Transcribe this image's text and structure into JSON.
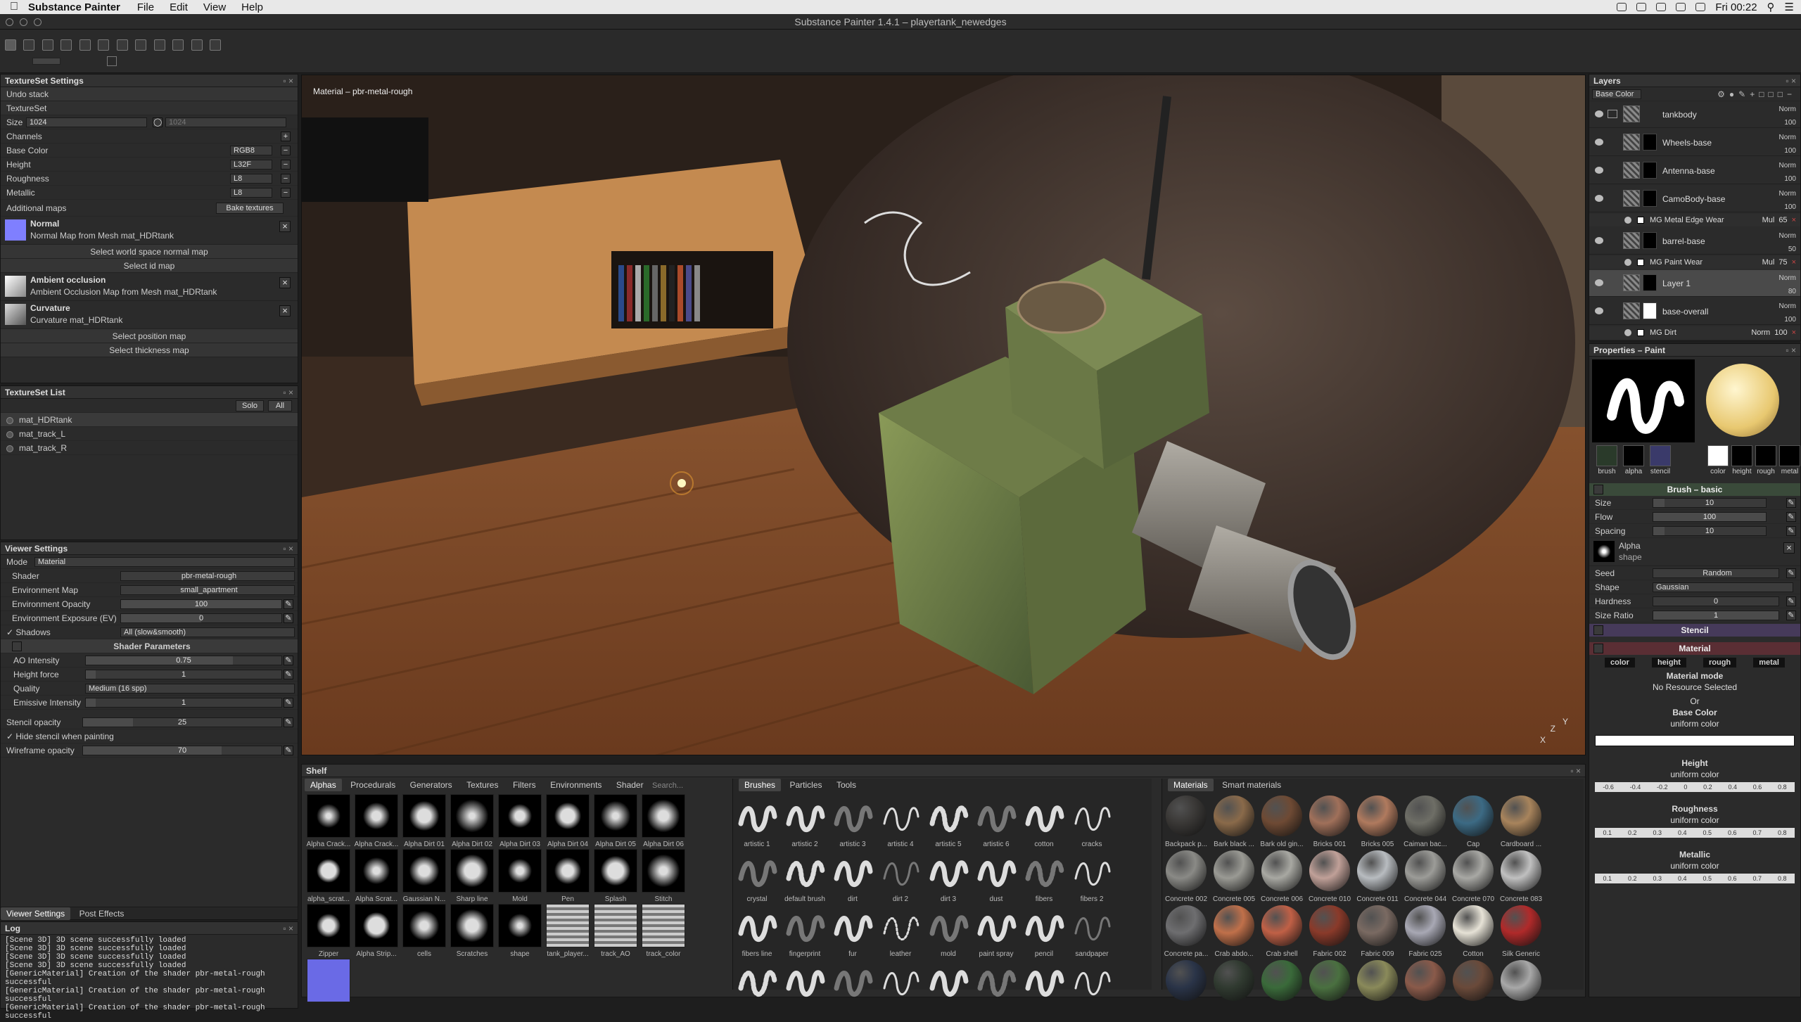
{
  "menubar": {
    "app": "Substance Painter",
    "items": [
      "File",
      "Edit",
      "View",
      "Help"
    ],
    "clock": "Fri 00:22"
  },
  "title": "Substance Painter 1.4.1 – playertank_newedges",
  "textureset_settings": {
    "title": "TextureSet Settings",
    "undo": "Undo stack",
    "section": "TextureSet",
    "size_label": "Size",
    "size_value": "1024",
    "size_value2": "1024",
    "channels_label": "Channels",
    "channels": [
      {
        "name": "Base Color",
        "format": "RGB8"
      },
      {
        "name": "Height",
        "format": "L32F"
      },
      {
        "name": "Roughness",
        "format": "L8"
      },
      {
        "name": "Metallic",
        "format": "L8"
      }
    ],
    "additional_maps": "Additional maps",
    "bake": "Bake textures",
    "normal_title": "Normal",
    "normal_sub": "Normal Map from Mesh mat_HDRtank",
    "world_normal": "Select world space normal map",
    "id_map": "Select id map",
    "ao_title": "Ambient occlusion",
    "ao_sub": "Ambient Occlusion Map from Mesh mat_HDRtank",
    "curv_title": "Curvature",
    "curv_sub": "Curvature mat_HDRtank",
    "position": "Select position map",
    "thickness": "Select thickness map"
  },
  "textureset_list": {
    "title": "TextureSet List",
    "solo": "Solo",
    "all": "All",
    "items": [
      "mat_HDRtank",
      "mat_track_L",
      "mat_track_R"
    ]
  },
  "viewer": {
    "title": "Viewer Settings",
    "mode_label": "Mode",
    "mode_value": "Material",
    "rows": [
      {
        "label": "Shader",
        "value": "pbr-metal-rough"
      },
      {
        "label": "Environment Map",
        "value": "small_apartment"
      },
      {
        "label": "Environment Opacity",
        "value": "100"
      },
      {
        "label": "Environment Exposure (EV)",
        "value": "0"
      }
    ],
    "shadows_label": "Shadows",
    "shadows_value": "All (slow&smooth)",
    "shader_params": "Shader Parameters",
    "ao_label": "AO Intensity",
    "ao_value": "0.75",
    "height_label": "Height force",
    "height_value": "1",
    "quality_label": "Quality",
    "quality_value": "Medium (16 spp)",
    "emissive_label": "Emissive Intensity",
    "emissive_value": "1",
    "stencil_label": "Stencil opacity",
    "stencil_value": "25",
    "hide_stencil": "Hide stencil when painting",
    "wire_label": "Wireframe opacity",
    "wire_value": "70",
    "tabs": [
      "Viewer Settings",
      "Post Effects"
    ]
  },
  "log": {
    "title": "Log",
    "lines": [
      "[Scene 3D] 3D scene successfully loaded",
      "[Scene 3D] 3D scene successfully loaded",
      "[Scene 3D] 3D scene successfully loaded",
      "[Scene 3D] 3D scene successfully loaded",
      "[GenericMaterial] Creation of the shader pbr-metal-rough successful",
      "[GenericMaterial] Creation of the shader pbr-metal-rough successful",
      "[GenericMaterial] Creation of the shader pbr-metal-rough successful"
    ]
  },
  "viewport": {
    "label": "Material – pbr-metal-rough",
    "axis_x": "X",
    "axis_y": "Y",
    "axis_z": "Z"
  },
  "shelf": {
    "title": "Shelf",
    "tabs": [
      "Alphas",
      "Procedurals",
      "Generators",
      "Textures",
      "Filters",
      "Environments",
      "Shader"
    ],
    "search": "Search...",
    "alphas": [
      "Alpha Crack...",
      "Alpha Crack...",
      "Alpha Dirt 01",
      "Alpha Dirt 02",
      "Alpha Dirt 03",
      "Alpha Dirt 04",
      "Alpha Dirt 05",
      "Alpha Dirt 06",
      "alpha_scrat...",
      "Alpha Scrat...",
      "Gaussian N...",
      "Sharp line",
      "Mold",
      "Pen",
      "Splash",
      "Stitch",
      "Zipper",
      "Alpha Strip...",
      "cells",
      "Scratches",
      "shape",
      "tank_player...",
      "track_AO",
      "track_color",
      ""
    ],
    "brush_tabs": [
      "Brushes",
      "Particles",
      "Tools"
    ],
    "brushes": [
      "artistic 1",
      "artistic 2",
      "artistic 3",
      "artistic 4",
      "artistic 5",
      "artistic 6",
      "cotton",
      "cracks",
      "crystal",
      "default brush",
      "dirt",
      "dirt 2",
      "dirt 3",
      "dust",
      "fibers",
      "fibers 2",
      "fibers line",
      "fingerprint",
      "fur",
      "leather",
      "mold",
      "paint spray",
      "pencil",
      "sandpaper",
      "",
      "",
      "",
      "",
      "",
      "",
      "",
      ""
    ],
    "mat_tabs": [
      "Materials",
      "Smart materials"
    ],
    "materials": [
      {
        "name": "Backpack p...",
        "color": "#3a3836"
      },
      {
        "name": "Bark black ...",
        "color": "#8a6a4a"
      },
      {
        "name": "Bark old gin...",
        "color": "#6e4a34"
      },
      {
        "name": "Bricks 001",
        "color": "#a0705a"
      },
      {
        "name": "Bricks 005",
        "color": "#b07a5e"
      },
      {
        "name": "Caiman bac...",
        "color": "#6e6e66"
      },
      {
        "name": "Cap",
        "color": "#3c6a84"
      },
      {
        "name": "Cardboard ...",
        "color": "#a8845c"
      },
      {
        "name": "Concrete 002",
        "color": "#8a8a86"
      },
      {
        "name": "Concrete 005",
        "color": "#9a9a94"
      },
      {
        "name": "Concrete 006",
        "color": "#a8a8a2"
      },
      {
        "name": "Concrete 010",
        "color": "#c0a098"
      },
      {
        "name": "Concrete 011",
        "color": "#b8bcc0"
      },
      {
        "name": "Concrete 044",
        "color": "#9c9c98"
      },
      {
        "name": "Concrete 070",
        "color": "#a8a8a4"
      },
      {
        "name": "Concrete 083",
        "color": "#c0c0c0"
      },
      {
        "name": "Concrete pa...",
        "color": "#6e6e70"
      },
      {
        "name": "Crab abdo...",
        "color": "#c0704a"
      },
      {
        "name": "Crab shell",
        "color": "#c06046"
      },
      {
        "name": "Fabric 002",
        "color": "#8a3a2a"
      },
      {
        "name": "Fabric 009",
        "color": "#7a6a62"
      },
      {
        "name": "Fabric 025",
        "color": "#a8a8b4"
      },
      {
        "name": "Cotton",
        "color": "#e6e2d6"
      },
      {
        "name": "Silk Generic",
        "color": "#b02a2a"
      },
      {
        "name": "",
        "color": "#2a3448"
      },
      {
        "name": "",
        "color": "#303a30"
      },
      {
        "name": "",
        "color": "#3a6a3a"
      },
      {
        "name": "",
        "color": "#4a7040"
      },
      {
        "name": "",
        "color": "#8a8a5a"
      },
      {
        "name": "",
        "color": "#8a5a4a"
      },
      {
        "name": "",
        "color": "#6a4a3a"
      },
      {
        "name": "",
        "color": "#a8a8a8"
      }
    ]
  },
  "layers": {
    "title": "Layers",
    "channel": "Base Color",
    "items": [
      {
        "name": "tankbody",
        "blend": "Norm",
        "opacity": "100",
        "folder": true
      },
      {
        "name": "Wheels-base",
        "blend": "Norm",
        "opacity": "100"
      },
      {
        "name": "Antenna-base",
        "blend": "Norm",
        "opacity": "100"
      },
      {
        "name": "CamoBody-base",
        "blend": "Norm",
        "opacity": "100",
        "sub": {
          "name": "MG Metal Edge Wear",
          "mode": "Mul",
          "value": "65"
        }
      },
      {
        "name": "barrel-base",
        "blend": "Norm",
        "opacity": "50",
        "sub": {
          "name": "MG Paint Wear",
          "mode": "Mul",
          "value": "75"
        }
      },
      {
        "name": "Layer 1",
        "blend": "Norm",
        "opacity": "80",
        "selected": true
      },
      {
        "name": "base-overall",
        "blend": "Norm",
        "opacity": "100",
        "sub": {
          "name": "MG Dirt",
          "mode": "Norm",
          "value": "100"
        }
      }
    ]
  },
  "properties": {
    "title": "Properties – Paint",
    "chips": [
      "brush",
      "alpha",
      "stencil",
      "color",
      "height",
      "rough",
      "metal"
    ],
    "brush_section": "Brush – basic",
    "size_label": "Size",
    "size_value": "10",
    "flow_label": "Flow",
    "flow_value": "100",
    "spacing_label": "Spacing",
    "spacing_value": "10",
    "alpha_label": "Alpha",
    "alpha_sub": "shape",
    "seed_label": "Seed",
    "seed_value": "Random",
    "shape_label": "Shape",
    "shape_value": "Gaussian",
    "hardness_label": "Hardness",
    "hardness_value": "0",
    "ratio_label": "Size Ratio",
    "ratio_value": "1",
    "stencil_section": "Stencil",
    "material_section": "Material",
    "mat_chips": [
      "color",
      "height",
      "rough",
      "metal"
    ],
    "material_mode": "Material mode",
    "no_resource": "No Resource Selected",
    "or": "Or",
    "base_color": "Base Color",
    "uniform": "uniform color",
    "height": "Height",
    "roughness": "Roughness",
    "metallic": "Metallic",
    "ticks_height": [
      "-0.6",
      "-0.4",
      "-0.2",
      "0",
      "0.2",
      "0.4",
      "0.6",
      "0.8"
    ],
    "ticks": [
      "0.1",
      "0.2",
      "0.3",
      "0.4",
      "0.5",
      "0.6",
      "0.7",
      "0.8"
    ]
  }
}
